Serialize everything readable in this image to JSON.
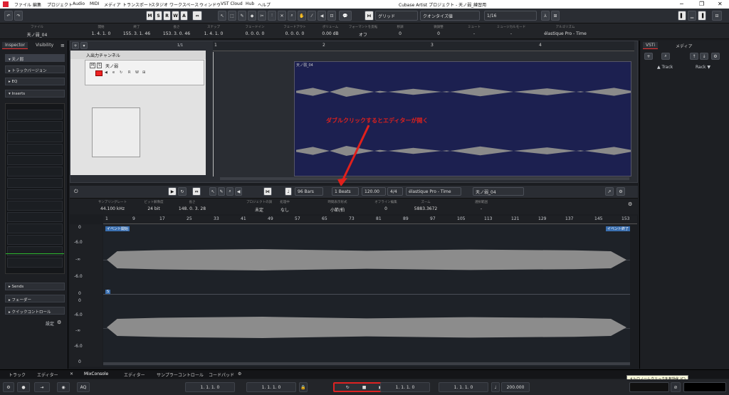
{
  "menubar": {
    "items": [
      "ファイル",
      "編集",
      "プロジェクト",
      "Audio",
      "MIDI",
      "メディア",
      "トランスポート",
      "スタジオ",
      "ワークスペース",
      "ウィンドウ",
      "VST Cloud",
      "Hub",
      "ヘルプ"
    ],
    "title": "Cubase Artist プロジェクト - 天ノ弱_練習用"
  },
  "toolbar": {
    "msrwa": [
      "M",
      "S",
      "R",
      "W",
      "A"
    ],
    "grid_label": "グリッド",
    "quantize_label": "クオンタイズ値",
    "quantize_value": "1/16"
  },
  "infoline": [
    {
      "l": "ファイル",
      "v": "天ノ弱_04"
    },
    {
      "l": "開始",
      "v": "1. 4. 1. 0"
    },
    {
      "l": "終了",
      "v": "155. 3. 1. 46"
    },
    {
      "l": "長さ",
      "v": "153. 3. 0. 46"
    },
    {
      "l": "スナップ",
      "v": "1. 4. 1. 0"
    },
    {
      "l": "フェードイン",
      "v": "0. 0. 0. 0"
    },
    {
      "l": "フェードアウト",
      "v": "0. 0. 0. 0"
    },
    {
      "l": "ボリューム",
      "v": "0.00 dB"
    },
    {
      "l": "フォーマントを反転",
      "v": "オフ"
    },
    {
      "l": "移調",
      "v": "0"
    },
    {
      "l": "微調整",
      "v": "0"
    },
    {
      "l": "ミュート",
      "v": "-"
    },
    {
      "l": "ミュージカルモード",
      "v": "-"
    },
    {
      "l": "アルゴリズム",
      "v": "élastique Pro - Time"
    }
  ],
  "inspector": {
    "tab1": "Inspector",
    "tab2": "Visibility",
    "track": "天ノ弱",
    "sections": [
      "トラックバージョン",
      "EQ",
      "Inserts"
    ],
    "bottom_sections": [
      "Sends",
      "フェーダー",
      "クイックコントロール"
    ],
    "settings": "設定"
  },
  "project": {
    "folder": "入出力チャンネル",
    "track_name": "天ノ弱",
    "counter": "1/1",
    "ruler": [
      "1",
      "2",
      "3",
      "4"
    ],
    "event_name": "天ノ弱_04"
  },
  "annotation": "ダブルクリックするとエディターが開く",
  "editor": {
    "zoom_bars": "96 Bars",
    "beats": "1 Beats",
    "tempo": "120.00",
    "sig": "4/4",
    "algo": "élastique Pro - Time",
    "file": "天ノ弱_04",
    "info": [
      {
        "l": "サンプリングレート",
        "v": "44.100 kHz"
      },
      {
        "l": "ビット解像度",
        "v": "24 bit"
      },
      {
        "l": "長さ",
        "v": "148. 0. 3. 28"
      },
      {
        "l": "プロジェクトの調",
        "v": "未定"
      },
      {
        "l": "処理中",
        "v": "なし"
      },
      {
        "l": "時間表示形式",
        "v": "小節/拍"
      },
      {
        "l": "オフライン編集",
        "v": "0"
      },
      {
        "l": "ズーム",
        "v": "5883.3672"
      },
      {
        "l": "選択範囲",
        "v": "-"
      }
    ],
    "ruler": [
      "1",
      "9",
      "17",
      "25",
      "33",
      "41",
      "49",
      "57",
      "65",
      "73",
      "81",
      "89",
      "97",
      "105",
      "113",
      "121",
      "129",
      "137",
      "145",
      "153"
    ],
    "event_start": "イベント開始",
    "event_end": "イベント終了",
    "s_marker": "S",
    "scale_top": [
      "0",
      "-6.0",
      "-∞",
      "-6.0",
      "0"
    ],
    "scale_bot": [
      "0",
      "-6.0",
      "-∞",
      "-6.0",
      "0"
    ]
  },
  "right": {
    "tab1": "VSTi",
    "tab2": "メディア",
    "track": "Track",
    "rack": "Rack"
  },
  "bottomtabs": [
    "トラック",
    "エディター",
    "MixConsole",
    "エディター",
    "サンプラーコントロール",
    "コードパッド"
  ],
  "transport": {
    "pos1": "1. 1. 1. 0",
    "pos2": "1. 1. 1. 0",
    "pos3": "1. 1. 1. 0",
    "pos4": "1. 1. 1. 0",
    "tempo": "200.000",
    "aq": "AQ",
    "tooltip": "メトロノームクリックを有効化 (C)"
  }
}
